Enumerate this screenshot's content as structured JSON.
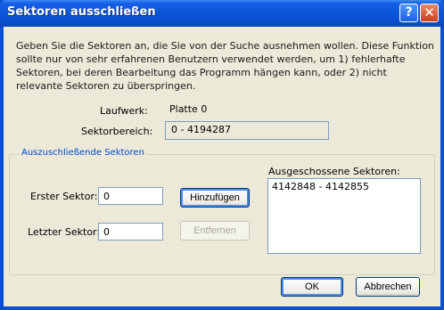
{
  "window": {
    "title": "Sektoren ausschließen",
    "help_label": "?",
    "close_label": "✕"
  },
  "description": "Geben Sie die Sektoren an, die Sie von der Suche ausnehmen wollen. Diese Funktion sollte nur von sehr erfahrenen Benutzern verwendet werden, um 1) fehlerhafte Sektoren, bei deren Bearbeitung das Programm hängen kann, oder 2) nicht relevante Sektoren zu überspringen.",
  "drive": {
    "label": "Laufwerk:",
    "value": "Platte 0"
  },
  "sector_range": {
    "label": "Sektorbereich:",
    "value": "0 - 4194287"
  },
  "group": {
    "title": "Auszuschließende Sektoren",
    "first_sector": {
      "label": "Erster Sektor:",
      "value": "0"
    },
    "last_sector": {
      "label": "Letzter Sektor:",
      "value": "0"
    },
    "add_button": "Hinzufügen",
    "remove_button": "Entfernen",
    "excluded_label": "Ausgeschossene Sektoren:",
    "excluded_items": [
      "4142848 - 4142855"
    ]
  },
  "footer": {
    "ok": "OK",
    "cancel": "Abbrechen"
  }
}
